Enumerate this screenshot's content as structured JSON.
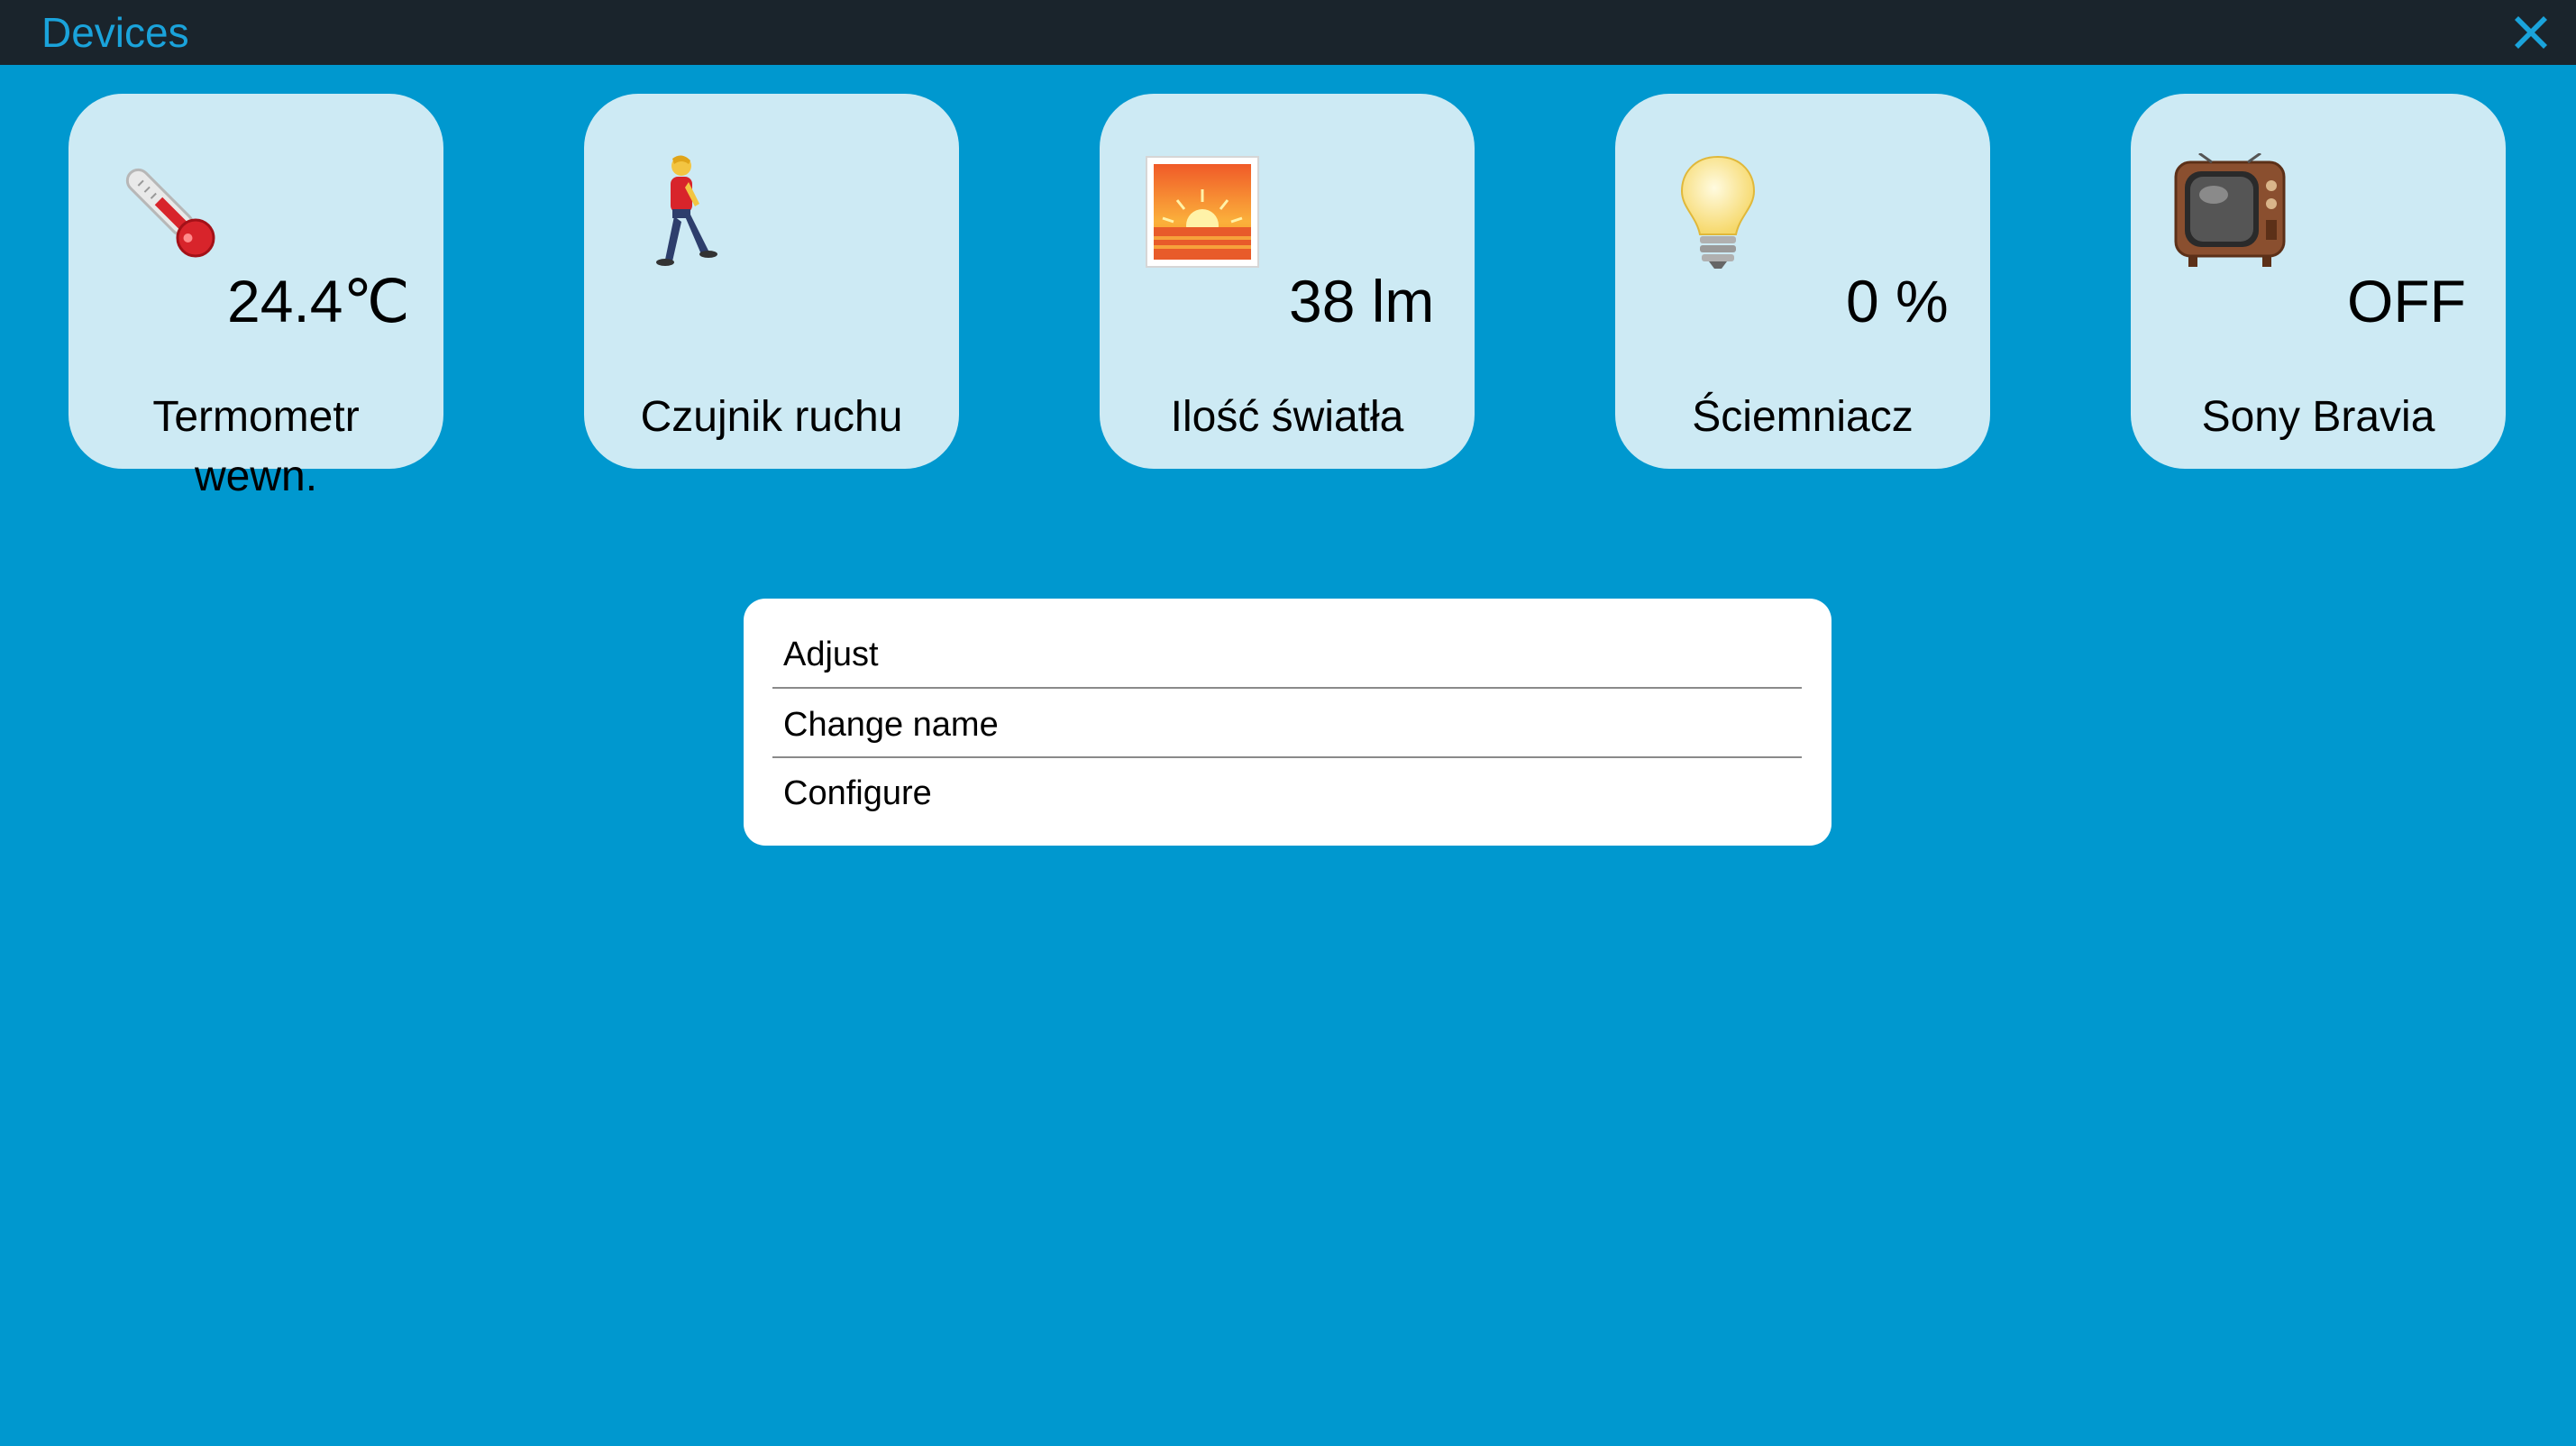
{
  "window": {
    "title": "Devices",
    "close_icon": "close-x-icon"
  },
  "devices": [
    {
      "icon": "thermometer-icon",
      "value": "24.4℃",
      "name_line1": "Termometr",
      "name_line2": "wewn."
    },
    {
      "icon": "walking-person-icon",
      "value": "",
      "name_line1": "Czujnik ruchu",
      "name_line2": ""
    },
    {
      "icon": "sunrise-picture-icon",
      "value": "38 lm",
      "name_line1": "Ilość światła",
      "name_line2": ""
    },
    {
      "icon": "light-bulb-icon",
      "value": "0 %",
      "name_line1": "Ściemniacz",
      "name_line2": ""
    },
    {
      "icon": "television-icon",
      "value": "OFF",
      "name_line1": "Sony Bravia",
      "name_line2": ""
    }
  ],
  "context_menu": {
    "items": [
      "Adjust",
      "Change name",
      "Configure"
    ]
  },
  "colors": {
    "background": "#0098cf",
    "titlebar": "#1a242c",
    "title_text": "#1aa3db",
    "tile": "#cdeaf4",
    "menu": "#ffffff"
  }
}
